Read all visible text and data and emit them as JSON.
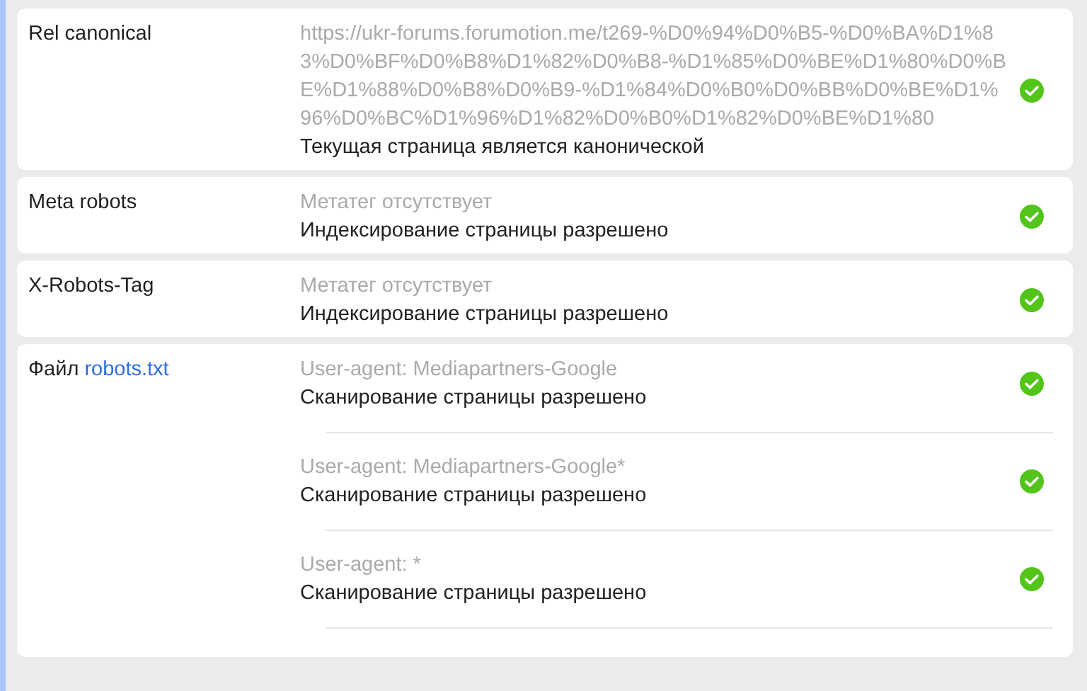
{
  "rows": [
    {
      "label": "Rel canonical",
      "checks": [
        {
          "detail": "https://ukr-forums.forumotion.me/t269-%D0%94%D0%B5-%D0%BA%D1%83%D0%BF%D0%B8%D1%82%D0%B8-%D1%85%D0%BE%D1%80%D0%BE%D1%88%D0%B8%D0%B9-%D1%84%D0%B0%D0%BB%D0%BE%D1%96%D0%BC%D1%96%D1%82%D0%B0%D1%82%D0%BE%D1%80",
          "result": "Текущая страница является канонической",
          "passed": true
        }
      ]
    },
    {
      "label": "Meta robots",
      "checks": [
        {
          "detail": "Метатег отсутствует",
          "result": "Индексирование страницы разрешено",
          "passed": true
        }
      ]
    },
    {
      "label": "X-Robots-Tag",
      "checks": [
        {
          "detail": "Метатег отсутствует",
          "result": "Индексирование страницы разрешено",
          "passed": true
        }
      ]
    },
    {
      "label": "Файл",
      "link": "robots.txt",
      "checks": [
        {
          "detail": "User-agent: Mediapartners-Google",
          "result": "Сканирование страницы разрешено",
          "passed": true
        },
        {
          "detail": "User-agent: Mediapartners-Google*",
          "result": "Сканирование страницы разрешено",
          "passed": true
        },
        {
          "detail": "User-agent: *",
          "result": "Сканирование страницы разрешено",
          "passed": true
        }
      ]
    }
  ]
}
